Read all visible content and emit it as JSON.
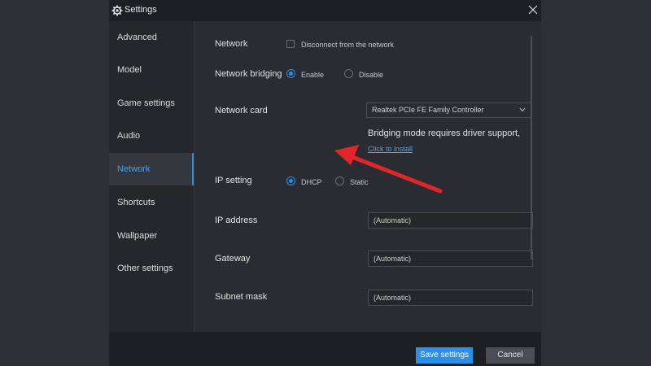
{
  "window": {
    "title": "Settings"
  },
  "sidebar": {
    "items": [
      {
        "label": "Advanced"
      },
      {
        "label": "Model"
      },
      {
        "label": "Game settings"
      },
      {
        "label": "Audio"
      },
      {
        "label": "Network"
      },
      {
        "label": "Shortcuts"
      },
      {
        "label": "Wallpaper"
      },
      {
        "label": "Other settings"
      }
    ],
    "active": "Network"
  },
  "network": {
    "network_label": "Network",
    "disconnect_label": "Disconnect from the network",
    "disconnect_checked": false,
    "bridging_label": "Network bridging",
    "bridging_enable": "Enable",
    "bridging_disable": "Disable",
    "bridging_selected": "Enable",
    "card_label": "Network card",
    "card_value": "Realtek PCIe FE Family Controller",
    "driver_note": "Bridging mode requires driver support,",
    "install_link": "Click to install",
    "ip_setting_label": "IP setting",
    "ip_dhcp": "DHCP",
    "ip_static": "Static",
    "ip_selected": "DHCP",
    "ip_address_label": "IP address",
    "ip_address_value": "(Automatic)",
    "gateway_label": "Gateway",
    "gateway_value": "(Automatic)",
    "subnet_label": "Subnet mask",
    "subnet_value": "(Automatic)"
  },
  "footer": {
    "save_label": "Save settings",
    "cancel_label": "Cancel"
  },
  "colors": {
    "accent": "#2d8ee8",
    "annotation_arrow": "#e0262b"
  },
  "icons": {
    "title": "gear-icon",
    "close": "close-icon",
    "select": "chevron-down-icon"
  }
}
